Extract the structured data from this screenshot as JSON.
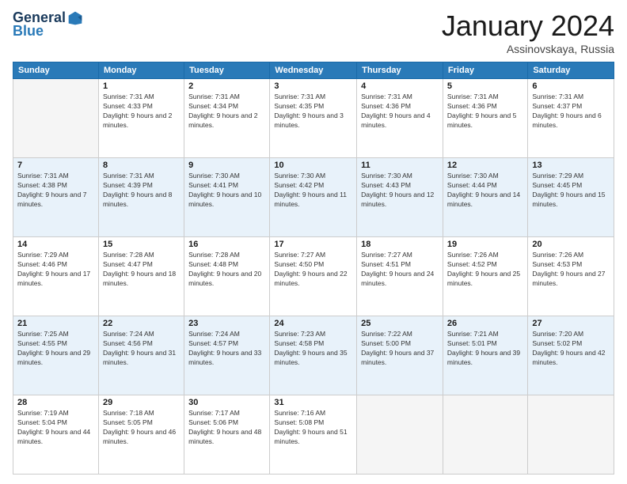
{
  "header": {
    "logo": {
      "general": "General",
      "blue": "Blue"
    },
    "title": "January 2024",
    "location": "Assinovskaya, Russia"
  },
  "days_header": [
    "Sunday",
    "Monday",
    "Tuesday",
    "Wednesday",
    "Thursday",
    "Friday",
    "Saturday"
  ],
  "weeks": [
    [
      {
        "day": "",
        "sunrise": "",
        "sunset": "",
        "daylight": "",
        "empty": true
      },
      {
        "day": "1",
        "sunrise": "Sunrise: 7:31 AM",
        "sunset": "Sunset: 4:33 PM",
        "daylight": "Daylight: 9 hours and 2 minutes."
      },
      {
        "day": "2",
        "sunrise": "Sunrise: 7:31 AM",
        "sunset": "Sunset: 4:34 PM",
        "daylight": "Daylight: 9 hours and 2 minutes."
      },
      {
        "day": "3",
        "sunrise": "Sunrise: 7:31 AM",
        "sunset": "Sunset: 4:35 PM",
        "daylight": "Daylight: 9 hours and 3 minutes."
      },
      {
        "day": "4",
        "sunrise": "Sunrise: 7:31 AM",
        "sunset": "Sunset: 4:36 PM",
        "daylight": "Daylight: 9 hours and 4 minutes."
      },
      {
        "day": "5",
        "sunrise": "Sunrise: 7:31 AM",
        "sunset": "Sunset: 4:36 PM",
        "daylight": "Daylight: 9 hours and 5 minutes."
      },
      {
        "day": "6",
        "sunrise": "Sunrise: 7:31 AM",
        "sunset": "Sunset: 4:37 PM",
        "daylight": "Daylight: 9 hours and 6 minutes."
      }
    ],
    [
      {
        "day": "7",
        "sunrise": "Sunrise: 7:31 AM",
        "sunset": "Sunset: 4:38 PM",
        "daylight": "Daylight: 9 hours and 7 minutes."
      },
      {
        "day": "8",
        "sunrise": "Sunrise: 7:31 AM",
        "sunset": "Sunset: 4:39 PM",
        "daylight": "Daylight: 9 hours and 8 minutes."
      },
      {
        "day": "9",
        "sunrise": "Sunrise: 7:30 AM",
        "sunset": "Sunset: 4:41 PM",
        "daylight": "Daylight: 9 hours and 10 minutes."
      },
      {
        "day": "10",
        "sunrise": "Sunrise: 7:30 AM",
        "sunset": "Sunset: 4:42 PM",
        "daylight": "Daylight: 9 hours and 11 minutes."
      },
      {
        "day": "11",
        "sunrise": "Sunrise: 7:30 AM",
        "sunset": "Sunset: 4:43 PM",
        "daylight": "Daylight: 9 hours and 12 minutes."
      },
      {
        "day": "12",
        "sunrise": "Sunrise: 7:30 AM",
        "sunset": "Sunset: 4:44 PM",
        "daylight": "Daylight: 9 hours and 14 minutes."
      },
      {
        "day": "13",
        "sunrise": "Sunrise: 7:29 AM",
        "sunset": "Sunset: 4:45 PM",
        "daylight": "Daylight: 9 hours and 15 minutes."
      }
    ],
    [
      {
        "day": "14",
        "sunrise": "Sunrise: 7:29 AM",
        "sunset": "Sunset: 4:46 PM",
        "daylight": "Daylight: 9 hours and 17 minutes."
      },
      {
        "day": "15",
        "sunrise": "Sunrise: 7:28 AM",
        "sunset": "Sunset: 4:47 PM",
        "daylight": "Daylight: 9 hours and 18 minutes."
      },
      {
        "day": "16",
        "sunrise": "Sunrise: 7:28 AM",
        "sunset": "Sunset: 4:48 PM",
        "daylight": "Daylight: 9 hours and 20 minutes."
      },
      {
        "day": "17",
        "sunrise": "Sunrise: 7:27 AM",
        "sunset": "Sunset: 4:50 PM",
        "daylight": "Daylight: 9 hours and 22 minutes."
      },
      {
        "day": "18",
        "sunrise": "Sunrise: 7:27 AM",
        "sunset": "Sunset: 4:51 PM",
        "daylight": "Daylight: 9 hours and 24 minutes."
      },
      {
        "day": "19",
        "sunrise": "Sunrise: 7:26 AM",
        "sunset": "Sunset: 4:52 PM",
        "daylight": "Daylight: 9 hours and 25 minutes."
      },
      {
        "day": "20",
        "sunrise": "Sunrise: 7:26 AM",
        "sunset": "Sunset: 4:53 PM",
        "daylight": "Daylight: 9 hours and 27 minutes."
      }
    ],
    [
      {
        "day": "21",
        "sunrise": "Sunrise: 7:25 AM",
        "sunset": "Sunset: 4:55 PM",
        "daylight": "Daylight: 9 hours and 29 minutes."
      },
      {
        "day": "22",
        "sunrise": "Sunrise: 7:24 AM",
        "sunset": "Sunset: 4:56 PM",
        "daylight": "Daylight: 9 hours and 31 minutes."
      },
      {
        "day": "23",
        "sunrise": "Sunrise: 7:24 AM",
        "sunset": "Sunset: 4:57 PM",
        "daylight": "Daylight: 9 hours and 33 minutes."
      },
      {
        "day": "24",
        "sunrise": "Sunrise: 7:23 AM",
        "sunset": "Sunset: 4:58 PM",
        "daylight": "Daylight: 9 hours and 35 minutes."
      },
      {
        "day": "25",
        "sunrise": "Sunrise: 7:22 AM",
        "sunset": "Sunset: 5:00 PM",
        "daylight": "Daylight: 9 hours and 37 minutes."
      },
      {
        "day": "26",
        "sunrise": "Sunrise: 7:21 AM",
        "sunset": "Sunset: 5:01 PM",
        "daylight": "Daylight: 9 hours and 39 minutes."
      },
      {
        "day": "27",
        "sunrise": "Sunrise: 7:20 AM",
        "sunset": "Sunset: 5:02 PM",
        "daylight": "Daylight: 9 hours and 42 minutes."
      }
    ],
    [
      {
        "day": "28",
        "sunrise": "Sunrise: 7:19 AM",
        "sunset": "Sunset: 5:04 PM",
        "daylight": "Daylight: 9 hours and 44 minutes."
      },
      {
        "day": "29",
        "sunrise": "Sunrise: 7:18 AM",
        "sunset": "Sunset: 5:05 PM",
        "daylight": "Daylight: 9 hours and 46 minutes."
      },
      {
        "day": "30",
        "sunrise": "Sunrise: 7:17 AM",
        "sunset": "Sunset: 5:06 PM",
        "daylight": "Daylight: 9 hours and 48 minutes."
      },
      {
        "day": "31",
        "sunrise": "Sunrise: 7:16 AM",
        "sunset": "Sunset: 5:08 PM",
        "daylight": "Daylight: 9 hours and 51 minutes."
      },
      {
        "day": "",
        "sunrise": "",
        "sunset": "",
        "daylight": "",
        "empty": true
      },
      {
        "day": "",
        "sunrise": "",
        "sunset": "",
        "daylight": "",
        "empty": true
      },
      {
        "day": "",
        "sunrise": "",
        "sunset": "",
        "daylight": "",
        "empty": true
      }
    ]
  ]
}
